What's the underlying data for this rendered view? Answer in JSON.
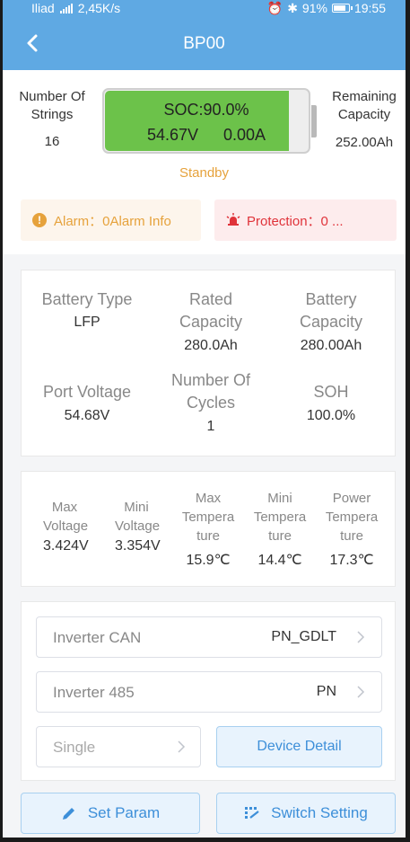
{
  "status_bar": {
    "carrier": "Iliad",
    "speed": "2,45K/s",
    "battery_percent": "91%",
    "time": "19:55"
  },
  "nav": {
    "title": "BP00"
  },
  "summary": {
    "strings_label": "Number Of Strings",
    "strings_value": "16",
    "soc_text": "SOC:90.0%",
    "soc_fraction": 0.9,
    "voltage": "54.67V",
    "current": "0.00A",
    "remaining_label": "Remaining Capacity",
    "remaining_value": "252.00Ah",
    "state": "Standby",
    "alarm": "Alarm：0Alarm Info",
    "protection": "Protection：0 ..."
  },
  "info": {
    "battery_type": {
      "label": "Battery Type",
      "value": "LFP"
    },
    "rated_capacity": {
      "label": "Rated Capacity",
      "value": "280.0Ah"
    },
    "battery_capacity": {
      "label": "Battery Capacity",
      "value": "280.00Ah"
    },
    "port_voltage": {
      "label": "Port Voltage",
      "value": "54.68V"
    },
    "cycles": {
      "label": "Number Of Cycles",
      "value": "1"
    },
    "soh": {
      "label": "SOH",
      "value": "100.0%"
    }
  },
  "temps": {
    "max_voltage": {
      "label": "Max Voltage",
      "value": "3.424V"
    },
    "mini_voltage": {
      "label": "Mini Voltage",
      "value": "3.354V"
    },
    "max_temp": {
      "label": "Max Tempera ture",
      "value": "15.9℃"
    },
    "mini_temp": {
      "label": "Mini Tempera ture",
      "value": "14.4℃"
    },
    "power_temp": {
      "label": "Power Tempera ture",
      "value": "17.3℃"
    }
  },
  "settings": {
    "inverter_can": {
      "label": "Inverter CAN",
      "value": "PN_GDLT"
    },
    "inverter_485": {
      "label": "Inverter 485",
      "value": "PN"
    },
    "mode": "Single",
    "device_detail": "Device Detail"
  },
  "bottom": {
    "set_param": "Set Param",
    "switch_setting": "Switch Setting"
  },
  "colors": {
    "accent": "#5fa9e3",
    "battery_green": "#6cc24a",
    "standby": "#e6a23c",
    "protection": "#e0333a",
    "link": "#3d8fd9"
  }
}
